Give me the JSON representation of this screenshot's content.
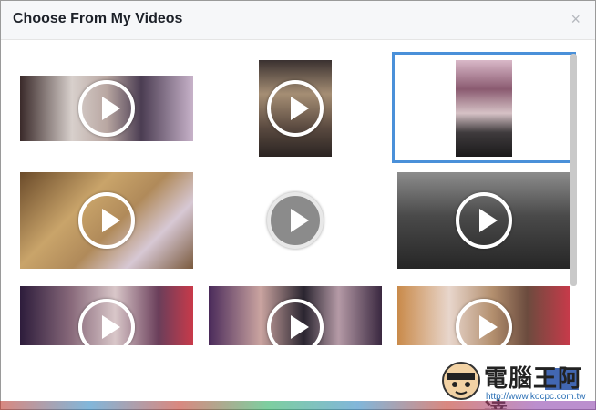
{
  "dialog": {
    "title": "Choose From My Videos",
    "close_glyph": "×"
  },
  "videos": [
    {
      "id": "video-1",
      "row": 1,
      "col": 1
    },
    {
      "id": "video-2",
      "row": 1,
      "col": 2
    },
    {
      "id": "video-3",
      "row": 1,
      "col": 3,
      "selected": true
    },
    {
      "id": "video-4",
      "row": 2,
      "col": 1
    },
    {
      "id": "video-5",
      "row": 2,
      "col": 2,
      "placeholder": true
    },
    {
      "id": "video-6",
      "row": 2,
      "col": 3
    },
    {
      "id": "video-7",
      "row": 3,
      "col": 1
    },
    {
      "id": "video-8",
      "row": 3,
      "col": 2
    },
    {
      "id": "video-9",
      "row": 3,
      "col": 3
    }
  ],
  "watermark": {
    "title": "電腦王阿達",
    "url": "http://www.kocpc.com.tw"
  },
  "colors": {
    "selection_border": "#4a90d9",
    "title_text": "#1d2129",
    "header_bg": "#f6f7f9",
    "primary_button": "#4267b2"
  },
  "icons": [
    "close-icon",
    "play-icon",
    "mouse-cursor-icon"
  ]
}
